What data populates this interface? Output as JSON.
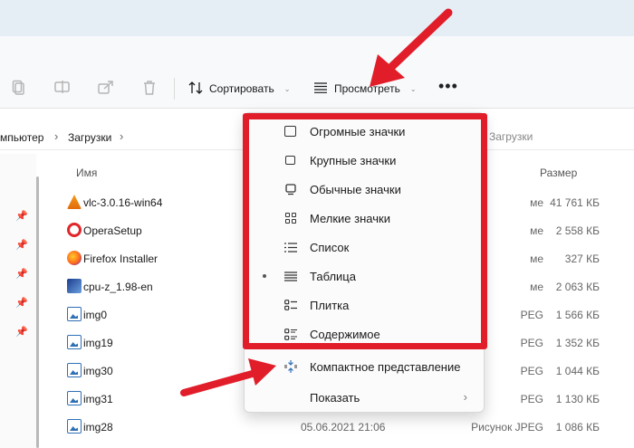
{
  "toolbar": {
    "sort_label": "Сортировать",
    "view_label": "Просмотреть",
    "more_label": "•••",
    "icons": [
      "copy-icon",
      "rename-icon",
      "share-icon",
      "delete-icon"
    ]
  },
  "breadcrumb": {
    "items": [
      "мпьютер",
      "Загрузки"
    ],
    "search_hint": "Загрузки"
  },
  "columns": {
    "name": "Имя",
    "size": "Размер"
  },
  "files": [
    {
      "name": "vlc-3.0.16-win64",
      "date": "",
      "type": "ме",
      "size": "41 761 КБ",
      "icon": "vlc-icon"
    },
    {
      "name": "OperaSetup",
      "date": "",
      "type": "ме",
      "size": "2 558 КБ",
      "icon": "opera-icon"
    },
    {
      "name": "Firefox Installer",
      "date": "",
      "type": "ме",
      "size": "327 КБ",
      "icon": "firefox-icon"
    },
    {
      "name": "cpu-z_1.98-en",
      "date": "",
      "type": "ме",
      "size": "2 063 КБ",
      "icon": "cpuz-icon"
    },
    {
      "name": "img0",
      "date": "",
      "type": "PEG",
      "size": "1 566 КБ",
      "icon": "image-file-icon"
    },
    {
      "name": "img19",
      "date": "",
      "type": "PEG",
      "size": "1 352 КБ",
      "icon": "image-file-icon"
    },
    {
      "name": "img30",
      "date": "",
      "type": "PEG",
      "size": "1 044 КБ",
      "icon": "image-file-icon"
    },
    {
      "name": "img31",
      "date": "",
      "type": "PEG",
      "size": "1 130 КБ",
      "icon": "image-file-icon"
    },
    {
      "name": "img28",
      "date": "05.06.2021 21:06",
      "type": "Рисунок JPEG",
      "size": "1 086 КБ",
      "icon": "image-file-icon"
    }
  ],
  "view_menu": {
    "items": [
      {
        "label": "Огромные значки",
        "icon": "extra-large-icons-icon",
        "selected": false
      },
      {
        "label": "Крупные значки",
        "icon": "large-icons-icon",
        "selected": false
      },
      {
        "label": "Обычные значки",
        "icon": "medium-icons-icon",
        "selected": false
      },
      {
        "label": "Мелкие значки",
        "icon": "small-icons-icon",
        "selected": false
      },
      {
        "label": "Список",
        "icon": "list-icon",
        "selected": false
      },
      {
        "label": "Таблица",
        "icon": "details-icon",
        "selected": true
      },
      {
        "label": "Плитка",
        "icon": "tiles-icon",
        "selected": false
      },
      {
        "label": "Содержимое",
        "icon": "content-icon",
        "selected": false
      },
      {
        "label": "Компактное представление",
        "icon": "compact-view-icon",
        "selected": false
      },
      {
        "label": "Показать",
        "icon": "",
        "selected": false,
        "submenu": true
      }
    ]
  },
  "colors": {
    "highlight_frame": "#e11d2a",
    "arrow": "#e11d2a",
    "accent": "#2f6fb5"
  }
}
